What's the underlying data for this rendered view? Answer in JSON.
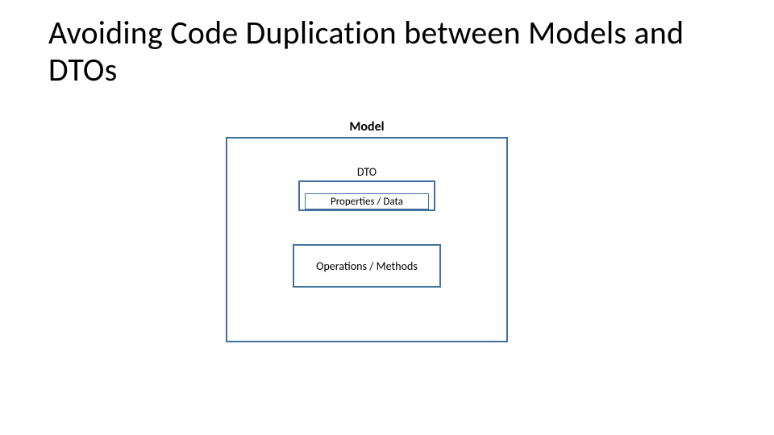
{
  "title": "Avoiding Code Duplication between Models and DTOs",
  "diagram": {
    "model_label": "Model",
    "dto_label": "DTO",
    "properties_label": "Properties / Data",
    "operations_label": "Operations / Methods"
  },
  "colors": {
    "box_border": "#41719c",
    "background": "#ffffff",
    "text": "#000000"
  }
}
